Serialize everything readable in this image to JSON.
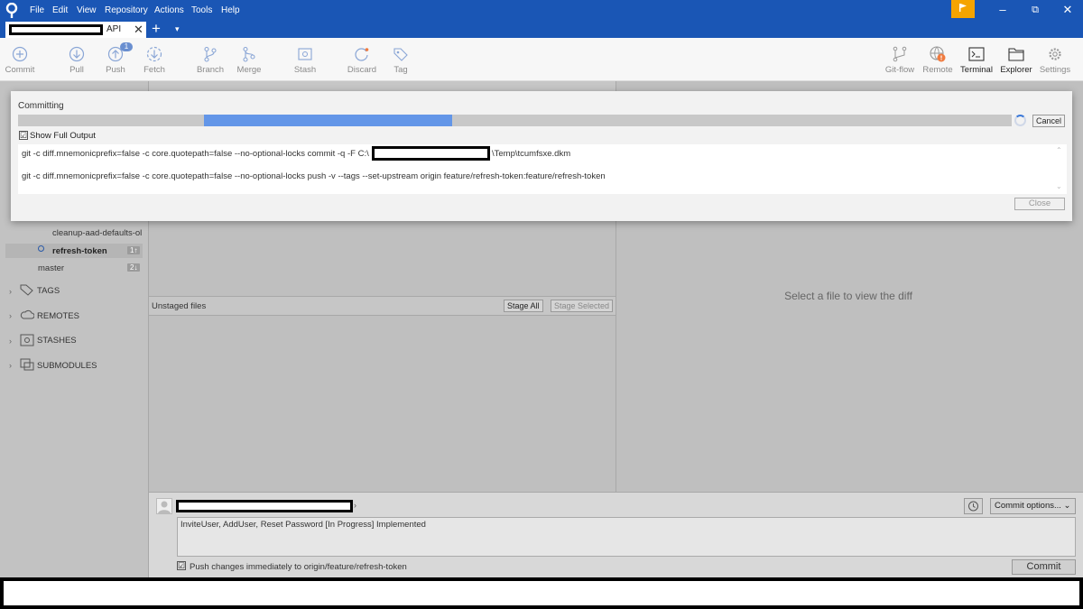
{
  "menu": [
    "File",
    "Edit",
    "View",
    "Repository",
    "Actions",
    "Tools",
    "Help"
  ],
  "window_controls": {
    "minimize": "–",
    "restore": "⧉",
    "close": "✕"
  },
  "tab": {
    "label_suffix": "API",
    "close": "✕",
    "add": "+",
    "dropdown": "▾"
  },
  "toolbar": {
    "commit": "Commit",
    "pull": "Pull",
    "push": "Push",
    "push_badge": "1",
    "fetch": "Fetch",
    "branch": "Branch",
    "merge": "Merge",
    "stash": "Stash",
    "discard": "Discard",
    "tag": "Tag",
    "gitflow": "Git-flow",
    "remote": "Remote",
    "terminal": "Terminal",
    "explorer": "Explorer",
    "settings": "Settings"
  },
  "sidebar": {
    "branches": [
      {
        "name": "cleanup-aad-defaults-ol",
        "count": ""
      },
      {
        "name": "refresh-token",
        "count": "1↑"
      },
      {
        "name": "master",
        "count": "2↓"
      }
    ],
    "sections": [
      "TAGS",
      "REMOTES",
      "STASHES",
      "SUBMODULES"
    ]
  },
  "files": {
    "unstaged_label": "Unstaged files",
    "stage_all": "Stage All",
    "stage_selected": "Stage Selected"
  },
  "diff": {
    "placeholder": "Select a file to view the diff"
  },
  "commit": {
    "message": "InviteUser, AddUser, Reset Password [In Progress] Implemented",
    "push_label": "Push changes immediately to origin/feature/refresh-token",
    "push_checked": "☑",
    "options": "Commit options... ⌄",
    "button": "Commit"
  },
  "dialog": {
    "title": "Committing",
    "progress_start": 0.187,
    "progress_end": 0.437,
    "cancel": "Cancel",
    "show_full_output": "Show Full Output",
    "output_line1_prefix": "git -c diff.mnemonicprefix=false -c core.quotepath=false --no-optional-locks commit -q -F C:\\",
    "output_line1_suffix": "\\Temp\\tcumfsxe.dkm",
    "output_line2": "git -c diff.mnemonicprefix=false -c core.quotepath=false --no-optional-locks push -v --tags --set-upstream origin feature/refresh-token:feature/refresh-token",
    "close": "Close"
  },
  "colors": {
    "titlebar": "#1a56b5",
    "accent_flag": "#f5a400",
    "progress": "#6396e8",
    "remote_alert": "#f07b3f"
  }
}
